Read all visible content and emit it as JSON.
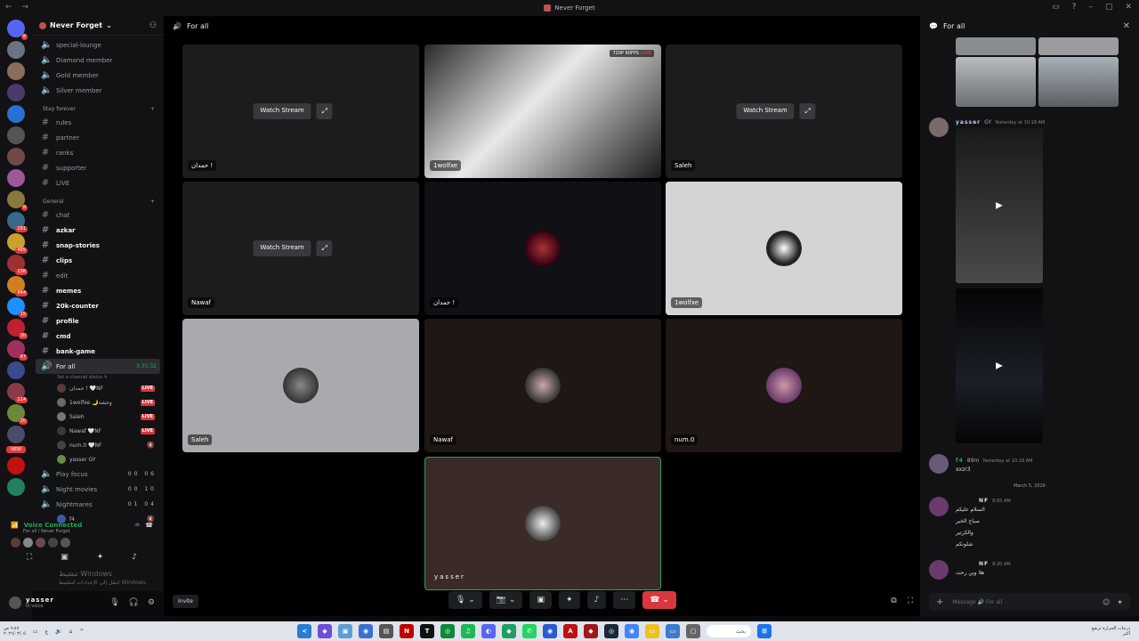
{
  "window": {
    "title": "Never Forget",
    "nav": "← →"
  },
  "rail": {
    "servers": [
      {
        "color": "#5865f2",
        "badge": "8"
      },
      {
        "color": "#6b7280",
        "badge": ""
      },
      {
        "color": "#8a6d5a",
        "badge": ""
      },
      {
        "color": "#4a3a6a",
        "badge": ""
      },
      {
        "color": "#2b6fd1",
        "badge": ""
      },
      {
        "color": "#555555",
        "badge": ""
      },
      {
        "color": "#704848",
        "badge": ""
      },
      {
        "color": "#9a5a9a",
        "badge": ""
      },
      {
        "color": "#8a7a3a",
        "badge": "8"
      },
      {
        "color": "#3a6a8a",
        "badge": "291"
      },
      {
        "color": "#caa030",
        "badge": "495"
      },
      {
        "color": "#a03030",
        "badge": "138"
      },
      {
        "color": "#d08020",
        "badge": "844"
      },
      {
        "color": "#1e90ff",
        "badge": "15"
      },
      {
        "color": "#c02030",
        "badge": "30"
      },
      {
        "color": "#a03060",
        "badge": "47"
      },
      {
        "color": "#3a4a8a",
        "badge": ""
      },
      {
        "color": "#8a3a4a",
        "badge": "114"
      },
      {
        "color": "#6a8a3a",
        "badge": "20"
      },
      {
        "color": "#4a4a6a",
        "badge": ""
      },
      {
        "color": "#c01010",
        "badge": ""
      },
      {
        "color": "#208060",
        "badge": ""
      }
    ],
    "new_label": "NEW"
  },
  "sidebar": {
    "server_name": "Never Forget",
    "top_channels": [
      {
        "name": "special-lounge"
      },
      {
        "name": "Diamond member"
      },
      {
        "name": "Gold member"
      },
      {
        "name": "Silver member"
      }
    ],
    "cat_stay": "Stay forever",
    "stay_channels": [
      {
        "name": "rules",
        "bold": false
      },
      {
        "name": "partner",
        "bold": false
      },
      {
        "name": "ranks",
        "bold": false
      },
      {
        "name": "supporter",
        "bold": false
      },
      {
        "name": "LIVE",
        "bold": false
      }
    ],
    "cat_general": "General",
    "general_channels": [
      {
        "name": "chat",
        "bold": false
      },
      {
        "name": "azkar",
        "bold": true
      },
      {
        "name": "snap-stories",
        "bold": true
      },
      {
        "name": "clips",
        "bold": true
      },
      {
        "name": "edit",
        "bold": false
      },
      {
        "name": "memes",
        "bold": true
      },
      {
        "name": "20k-counter",
        "bold": true
      },
      {
        "name": "profile",
        "bold": true
      },
      {
        "name": "cmd",
        "bold": true
      },
      {
        "name": "bank-game",
        "bold": true
      }
    ],
    "voice_active": {
      "name": "For all",
      "timer": "3:35:32",
      "status": "Set a channel status ✎"
    },
    "voice_users": [
      {
        "name": "حمدان ! 🤍NF",
        "tag": "LIVE",
        "color": "#5a3a3a"
      },
      {
        "name": "1wolfxe 🌙وحشة",
        "tag": "LIVE",
        "color": "#6a6a6a"
      },
      {
        "name": "Saleh",
        "tag": "LIVE",
        "color": "#777777"
      },
      {
        "name": "Nawaf 🤍NF",
        "tag": "LIVE",
        "color": "#3a3a3a"
      },
      {
        "name": "num.0 🤍NF",
        "tag": "🔇",
        "color": "#444444"
      },
      {
        "name": "yasser  GY",
        "tag": "",
        "color": "#6a8a4a"
      }
    ],
    "other_voice": [
      {
        "name": "Play focus",
        "counts": "00 06"
      },
      {
        "name": "Night movies",
        "counts": "00 10"
      },
      {
        "name": "Nightmares",
        "counts": "01 04"
      }
    ],
    "last_user": {
      "name": "f4",
      "tag": "🔇"
    }
  },
  "voice_panel": {
    "title": "Voice Connected",
    "sub": "For all / Never Forget",
    "avatars": [
      "#5a3a3a",
      "#888888",
      "#6a4a4a",
      "#444444",
      "#555555"
    ]
  },
  "user_panel": {
    "name": "yasser",
    "status": "In voice"
  },
  "watermark": {
    "line1": "تنشيط Windows",
    "line2": "انتقل إلى الإعدادات لتنشيط Windows."
  },
  "stage": {
    "channel": "For all",
    "watch_label": "Watch Stream",
    "invite": "Invite",
    "quality_badge": "720P 60FPS",
    "live_label": "LIVE",
    "tiles": [
      {
        "name": "حمدان !",
        "kind": "stream-idle"
      },
      {
        "name": "1wolfxe",
        "kind": "stream-live"
      },
      {
        "name": "Saleh",
        "kind": "stream-idle"
      },
      {
        "name": "Nawaf",
        "kind": "stream-idle"
      },
      {
        "name": "حمدان !",
        "kind": "camera"
      },
      {
        "name": "1wolfxe",
        "kind": "avatar-light"
      },
      {
        "name": "Saleh",
        "kind": "avatar-light"
      },
      {
        "name": "Nawaf",
        "kind": "avatar-dark"
      },
      {
        "name": "num.0",
        "kind": "avatar-dark"
      },
      {
        "name": "yasser",
        "kind": "self"
      }
    ]
  },
  "chat": {
    "title": "For all",
    "messages": [
      {
        "user": "yasser",
        "tag": "GY",
        "time": "Yesterday at 10:18 AM",
        "user_color": "#c9cdfb"
      },
      {
        "user": "f4",
        "tag": "89m",
        "time": "Yesterday at 10:18 AM",
        "user_color": "#23a559",
        "text": "xxzr3"
      }
    ],
    "date_divider": "March 5, 2026",
    "arabic_msgs": [
      {
        "user": "NF",
        "time": "8:05 AM",
        "lines": [
          "السلام عليكم",
          "صباح الخير",
          "والكرتير",
          "شلونكم"
        ]
      },
      {
        "user": "NF",
        "time": "8:20 AM",
        "lines": [
          "هلا وين رحت"
        ]
      }
    ],
    "placeholder": "Message 🔊 For all"
  },
  "taskbar": {
    "search": "بحث",
    "clock": "٩:٤٧ ص\n٢٠٢٦/٠٣/٠٥",
    "weather": "درجات الحرارة ترتفع\nأكثر",
    "apps": [
      {
        "c": "#2b7bd1",
        "g": "<"
      },
      {
        "c": "#6b4fd8",
        "g": "◆"
      },
      {
        "c": "#5a9fd6",
        "g": "▣"
      },
      {
        "c": "#3a6fd0",
        "g": "◉"
      },
      {
        "c": "#555",
        "g": "▤"
      },
      {
        "c": "#c00000",
        "g": "N"
      },
      {
        "c": "#111",
        "g": "T"
      },
      {
        "c": "#0a8a3a",
        "g": "◎"
      },
      {
        "c": "#1db954",
        "g": "♫"
      },
      {
        "c": "#5865f2",
        "g": "◐"
      },
      {
        "c": "#20a060",
        "g": "◆"
      },
      {
        "c": "#25d366",
        "g": "✆"
      },
      {
        "c": "#2a5ad0",
        "g": "◉"
      },
      {
        "c": "#c01010",
        "g": "A"
      },
      {
        "c": "#a01818",
        "g": "◆"
      },
      {
        "c": "#1b2838",
        "g": "◎"
      },
      {
        "c": "#4285f4",
        "g": "◉"
      },
      {
        "c": "#f0c020",
        "g": "▭"
      },
      {
        "c": "#3a7ad0",
        "g": "▭"
      },
      {
        "c": "#666",
        "g": "▢"
      }
    ]
  }
}
